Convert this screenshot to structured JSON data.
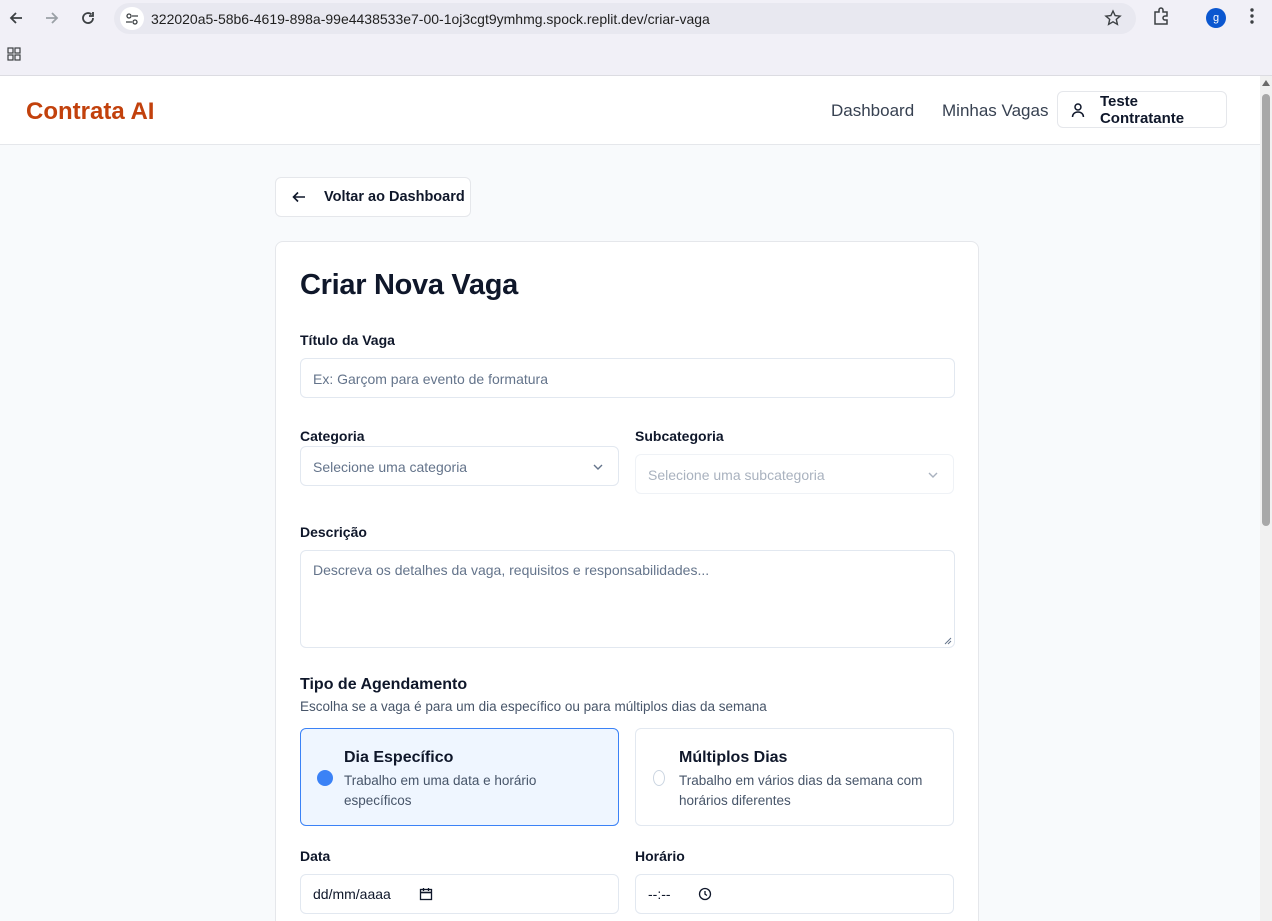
{
  "browser": {
    "url": "322020a5-58b6-4619-898a-99e4438533e7-00-1oj3cgt9ymhmg.spock.replit.dev/criar-vaga",
    "profile_initial": "g"
  },
  "header": {
    "logo": "Contrata AI",
    "nav": [
      "Dashboard",
      "Minhas Vagas"
    ],
    "user_label": "Teste Contratante"
  },
  "back_button": "Voltar ao Dashboard",
  "form": {
    "title": "Criar Nova Vaga",
    "job_title": {
      "label": "Título da Vaga",
      "placeholder": "Ex: Garçom para evento de formatura"
    },
    "category": {
      "label": "Categoria",
      "placeholder": "Selecione uma categoria"
    },
    "subcategory": {
      "label": "Subcategoria",
      "placeholder": "Selecione uma subcategoria"
    },
    "description": {
      "label": "Descrição",
      "placeholder": "Descreva os detalhes da vaga, requisitos e responsabilidades..."
    },
    "schedule": {
      "title": "Tipo de Agendamento",
      "subtitle": "Escolha se a vaga é para um dia específico ou para múltiplos dias da semana",
      "options": [
        {
          "title": "Dia Específico",
          "desc": "Trabalho em uma data e horário específicos",
          "selected": true
        },
        {
          "title": "Múltiplos Dias",
          "desc": "Trabalho em vários dias da semana com horários diferentes",
          "selected": false
        }
      ]
    },
    "date": {
      "label": "Data",
      "value": "dd/mm/aaaa"
    },
    "time": {
      "label": "Horário",
      "value": "--:--"
    }
  },
  "colors": {
    "brand": "#c2410c",
    "accent": "#3b82f6"
  }
}
